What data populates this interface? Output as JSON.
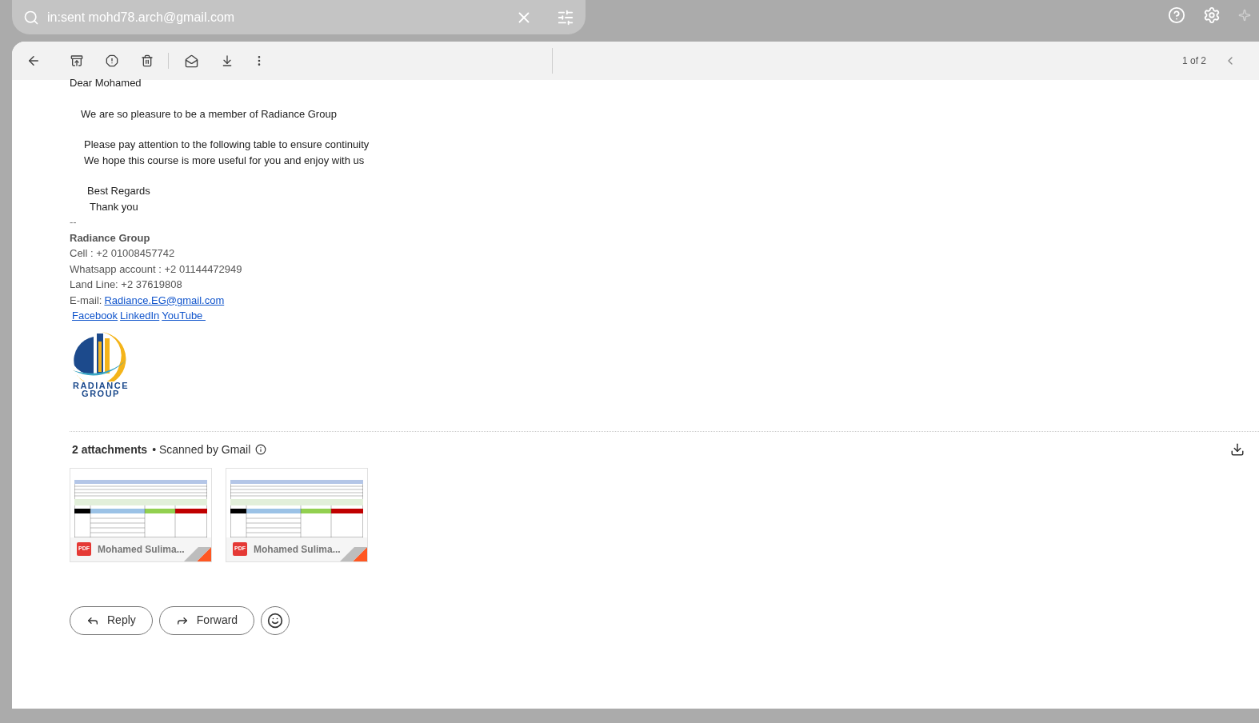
{
  "search": {
    "value": "in:sent mohd78.arch@gmail.com"
  },
  "pager": {
    "label": "1 of 2"
  },
  "message": {
    "greeting": "Dear Mohamed",
    "paragraphs": [
      "We are so pleasure to be a member of Radiance Group",
      "Please pay attention to the following table to ensure continuity",
      "We hope this course is more useful for you and enjoy with us",
      "Best Regards",
      "Thank you"
    ],
    "separator": "--",
    "signature": {
      "name": "Radiance Group",
      "lines": [
        "Cell : +2 01008457742",
        "Whatsapp account : +2 01144472949",
        "Land Line: +2 37619808"
      ],
      "email_label": "E-mail:",
      "email": "Radiance.EG@gmail.com",
      "links": [
        "Facebook",
        "LinkedIn",
        "YouTube "
      ],
      "logo_text": [
        "RADIANCE",
        "GROUP"
      ]
    }
  },
  "attachments": {
    "count_label": "2 attachments",
    "scanned": "• Scanned by Gmail",
    "files": [
      {
        "type": "PDF",
        "name": "Mohamed Sulima..."
      },
      {
        "type": "PDF",
        "name": "Mohamed Sulima..."
      }
    ]
  },
  "actions": [
    {
      "kind": "reply",
      "label": "Reply"
    },
    {
      "kind": "forward",
      "label": "Forward"
    },
    {
      "kind": "emoji"
    }
  ]
}
